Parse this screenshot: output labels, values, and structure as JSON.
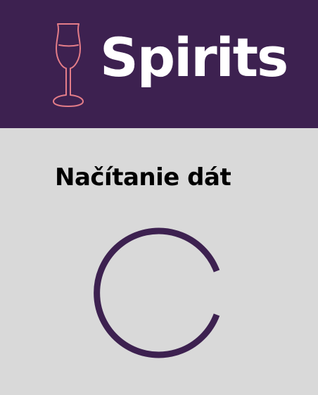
{
  "header": {
    "brand_name": "Spirits",
    "logo_icon": "wine-glass-icon",
    "background_color": "#3d2150",
    "logo_color": "#e47d88"
  },
  "main": {
    "loading_text": "Načítanie dát",
    "spinner_icon": "loading-spinner-icon",
    "spinner_color": "#3d2150",
    "background_color": "#d9d9d9"
  }
}
